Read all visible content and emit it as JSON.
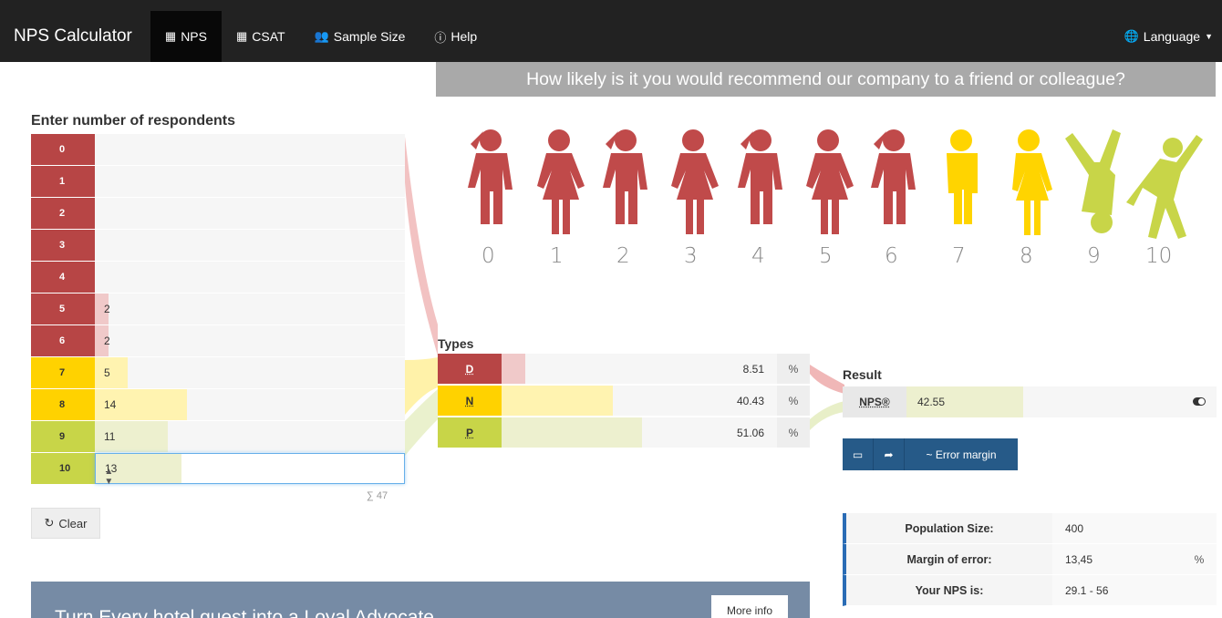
{
  "navbar": {
    "brand": "NPS Calculator",
    "items": [
      {
        "label": "NPS",
        "icon": "calculator-icon",
        "active": true
      },
      {
        "label": "CSAT",
        "icon": "calculator-icon",
        "active": false
      },
      {
        "label": "Sample Size",
        "icon": "users-icon",
        "active": false
      },
      {
        "label": "Help",
        "icon": "info-circle-icon",
        "active": false
      }
    ],
    "language": "Language"
  },
  "question": "How likely is it you would recommend our company to a friend or colleague?",
  "respondents": {
    "title": "Enter number of respondents",
    "rows": [
      {
        "score": "0",
        "value": "",
        "fraction": 0
      },
      {
        "score": "1",
        "value": "",
        "fraction": 0
      },
      {
        "score": "2",
        "value": "",
        "fraction": 0
      },
      {
        "score": "3",
        "value": "",
        "fraction": 0
      },
      {
        "score": "4",
        "value": "",
        "fraction": 0
      },
      {
        "score": "5",
        "value": "2",
        "fraction": 0.043
      },
      {
        "score": "6",
        "value": "2",
        "fraction": 0.043
      },
      {
        "score": "7",
        "value": "5",
        "fraction": 0.106
      },
      {
        "score": "8",
        "value": "14",
        "fraction": 0.298
      },
      {
        "score": "9",
        "value": "11",
        "fraction": 0.234
      },
      {
        "score": "10",
        "value": "13",
        "fraction": 0.277
      }
    ],
    "sum": "∑ 47",
    "clear_label": "Clear"
  },
  "scale_labels": [
    "0",
    "1",
    "2",
    "3",
    "4",
    "5",
    "6",
    "7",
    "8",
    "9",
    "10"
  ],
  "types": {
    "title": "Types",
    "rows": [
      {
        "label": "D",
        "value": "8.51",
        "unit": "%",
        "fraction": 0.0851
      },
      {
        "label": "N",
        "value": "40.43",
        "unit": "%",
        "fraction": 0.4043
      },
      {
        "label": "P",
        "value": "51.06",
        "unit": "%",
        "fraction": 0.5106
      }
    ]
  },
  "result": {
    "title": "Result",
    "label": "NPS®",
    "value": "42.55",
    "fraction": 0.4255,
    "error_margin_label": "~ Error margin"
  },
  "stats": [
    {
      "label": "Population Size:",
      "value": "400",
      "unit": ""
    },
    {
      "label": "Margin of error:",
      "value": "13,45",
      "unit": "%"
    },
    {
      "label": "Your NPS is:",
      "value": "29.1 - 56",
      "unit": ""
    }
  ],
  "promo": {
    "text": "Turn Every hotel guest into a Loyal Advocate",
    "button": "More info"
  },
  "colors": {
    "detractor": "#b74545",
    "passive": "#ffd200",
    "promoter": "#c8d548",
    "navbar": "#222222",
    "accent": "#265a88"
  }
}
